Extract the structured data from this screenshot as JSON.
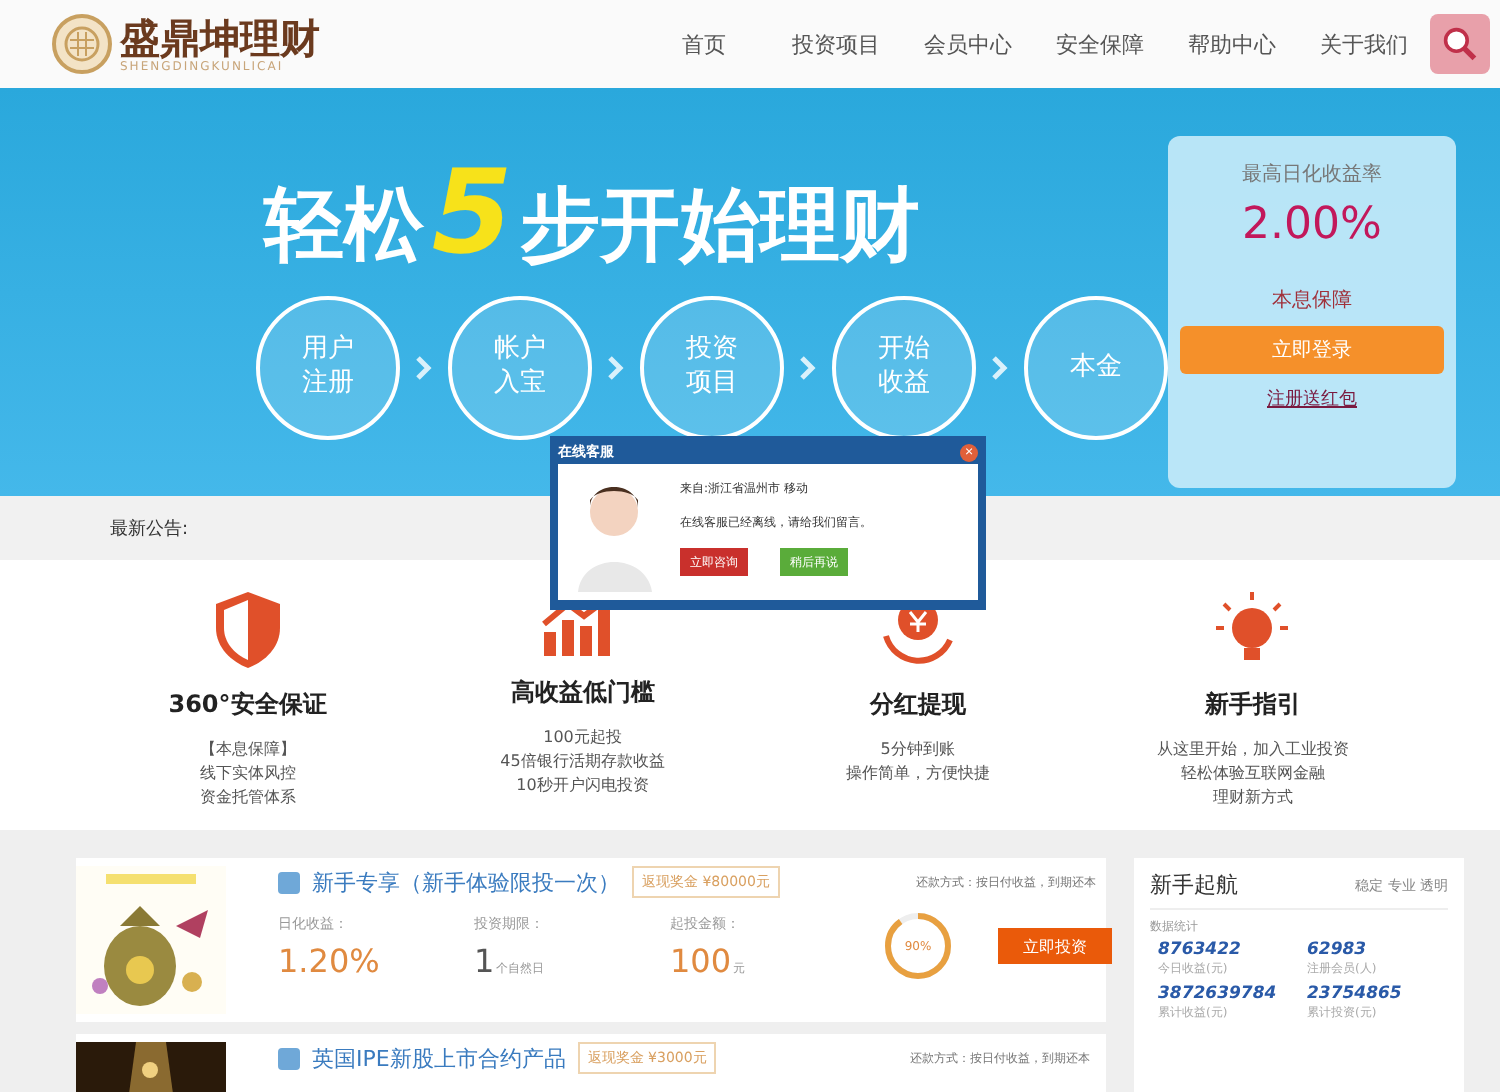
{
  "header": {
    "logo_text": "盛鼎坤理财",
    "logo_sub": "SHENGDINGKUNLICAI",
    "nav": [
      {
        "label": "首页",
        "selected": false
      },
      {
        "label": "投资项目",
        "selected": false
      },
      {
        "label": "会员中心",
        "selected": false
      },
      {
        "label": "安全保障",
        "selected": false
      },
      {
        "label": "帮助中心",
        "selected": false
      },
      {
        "label": "关于我们",
        "selected": false
      }
    ]
  },
  "banner": {
    "title_before": "轻松",
    "title_number": "5",
    "title_after": "步开始理财",
    "steps": [
      "用户注册",
      "帐户入宝",
      "投资项目",
      "开始收益",
      "本金"
    ],
    "card": {
      "label": "最高日化收益率",
      "rate": "2.00%",
      "guarantee": "本息保障",
      "login_button": "立即登录",
      "register_link": "注册送红包"
    }
  },
  "notice": {
    "label": "最新公告:"
  },
  "popup": {
    "title": "在线客服",
    "close": "×",
    "from": "来自:浙江省温州市 移动",
    "message": "在线客服已经离线，请给我们留言。",
    "buttons": [
      {
        "label": "立即咨询",
        "kind": "primary"
      },
      {
        "label": "稍后再说",
        "kind": "secondary"
      }
    ]
  },
  "features": [
    {
      "kind": "shield",
      "title": "360°安全保证",
      "lines": [
        "【本息保障】",
        "线下实体风控",
        "资金托管体系"
      ]
    },
    {
      "kind": "chart",
      "title": "高收益低门槛",
      "lines": [
        "100元起投",
        "45倍银行活期存款收益",
        "10秒开户闪电投资"
      ]
    },
    {
      "kind": "cycle",
      "title": "分红提现",
      "lines": [
        "5分钟到账",
        "操作简单，方便快捷"
      ]
    },
    {
      "kind": "bulb",
      "title": "新手指引",
      "lines": [
        "从这里开始，加入工业投资",
        "轻松体验互联网金融",
        "理财新方式"
      ]
    }
  ],
  "products": [
    {
      "name": "新手专享（新手体验限投一次）",
      "badge": "返现奖金 ¥80000元",
      "repay": "还款方式：按日付收益，到期还本",
      "rate_label": "日化收益：",
      "rate": "1.20%",
      "term_label": "投资期限：",
      "term": "1",
      "term_unit": "个自然日",
      "min_label": "起投金额：",
      "min": "100",
      "min_unit": "元",
      "progress_label": "90%",
      "level": 0.9,
      "button": "立即投资"
    },
    {
      "name": "英国IPE新股上市合约产品",
      "badge": "返现奖金 ¥3000元",
      "repay": "还款方式：按日付收益，到期还本"
    }
  ],
  "sidebar": {
    "title": "新手起航",
    "tagline": "稳定 专业 透明",
    "stats_label": "数据统计",
    "stats": [
      {
        "value": "8763422",
        "label": "今日收益(元)"
      },
      {
        "value": "62983",
        "label": "注册会员(人)"
      },
      {
        "value": "3872639784",
        "label": "累计收益(元)"
      },
      {
        "value": "23754865",
        "label": "累计投资(元)"
      }
    ]
  }
}
